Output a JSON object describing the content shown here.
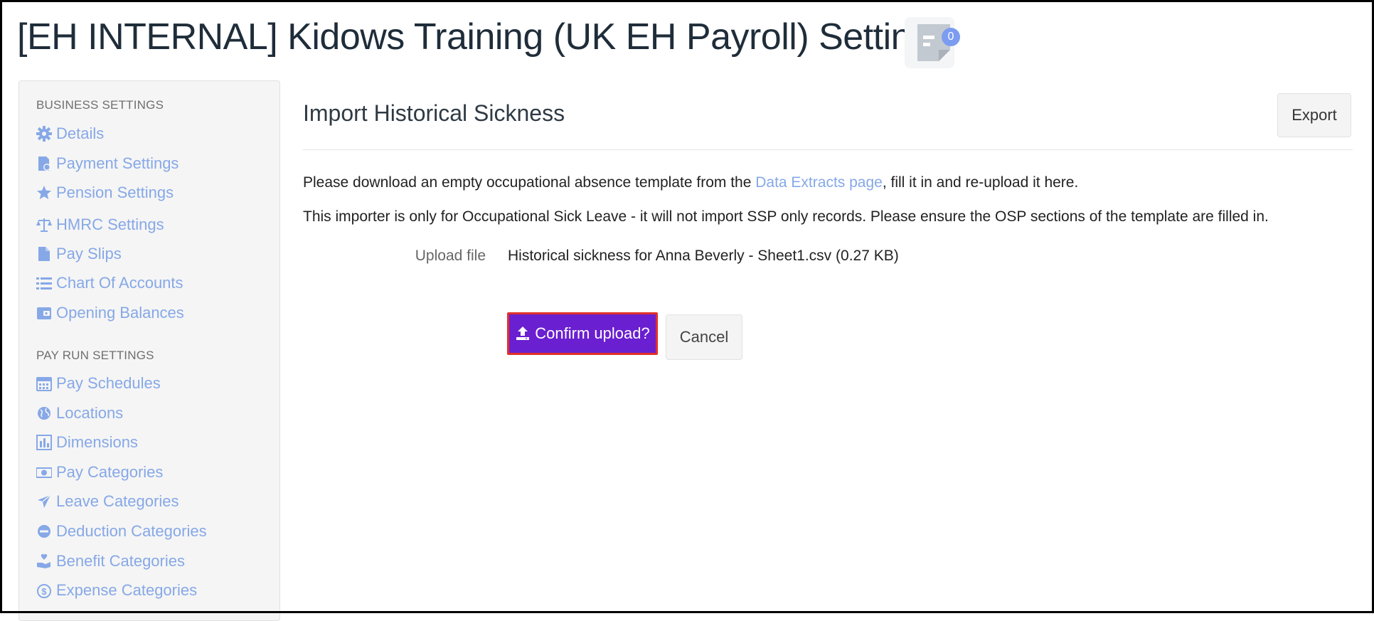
{
  "page": {
    "title": "[EH INTERNAL] Kidows Training (UK EH Payroll) Settings",
    "notes_count": "0"
  },
  "sidebar": {
    "business_heading": "BUSINESS SETTINGS",
    "business_items": [
      {
        "label": "Details",
        "icon": "gear-icon"
      },
      {
        "label": "Payment Settings",
        "icon": "payment-doc-icon"
      },
      {
        "label": "Pension Settings",
        "icon": "star-icon"
      },
      {
        "label": "HMRC Settings",
        "icon": "scales-icon"
      },
      {
        "label": "Pay Slips",
        "icon": "file-icon"
      },
      {
        "label": "Chart Of Accounts",
        "icon": "list-icon"
      },
      {
        "label": "Opening Balances",
        "icon": "wallet-icon"
      }
    ],
    "payrun_heading": "PAY RUN SETTINGS",
    "payrun_items": [
      {
        "label": "Pay Schedules",
        "icon": "calendar-icon"
      },
      {
        "label": "Locations",
        "icon": "globe-icon"
      },
      {
        "label": "Dimensions",
        "icon": "bar-chart-icon"
      },
      {
        "label": "Pay Categories",
        "icon": "money-icon"
      },
      {
        "label": "Leave Categories",
        "icon": "plane-icon"
      },
      {
        "label": "Deduction Categories",
        "icon": "minus-circle-icon"
      },
      {
        "label": "Benefit Categories",
        "icon": "hand-heart-icon"
      },
      {
        "label": "Expense Categories",
        "icon": "dollar-circle-icon"
      }
    ]
  },
  "main": {
    "title": "Import Historical Sickness",
    "export_label": "Export",
    "intro_before": "Please download an empty occupational absence template from the ",
    "intro_link": "Data Extracts page",
    "intro_after": ", fill it in and re-upload it here.",
    "notice": "This importer is only for Occupational Sick Leave - it will not import SSP only records. Please ensure the OSP sections of the template are filled in.",
    "upload_label": "Upload file",
    "upload_value": "Historical sickness for Anna Beverly - Sheet1.csv (0.27 KB)",
    "confirm_label": "Confirm upload?",
    "cancel_label": "Cancel"
  },
  "colors": {
    "accent_link": "#86a8e7",
    "confirm_bg": "#6a1fd0",
    "confirm_border": "#e0302a"
  }
}
